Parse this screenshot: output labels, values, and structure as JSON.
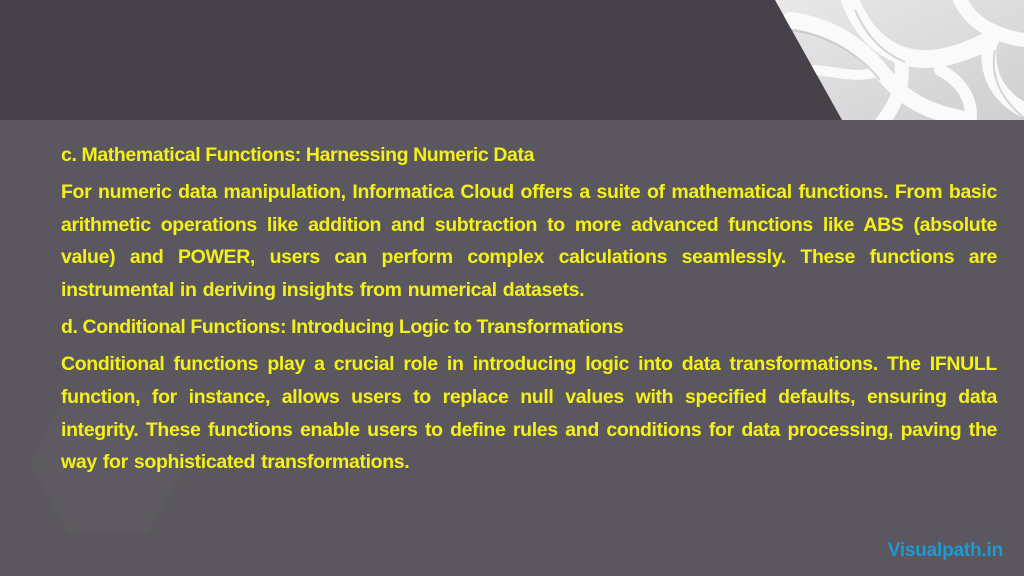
{
  "slide": {
    "colors": {
      "top_band": "#474249",
      "background": "#5a585e",
      "text": "#f4f01a",
      "brand": "#1a9ad6"
    },
    "sections": [
      {
        "heading": "c. Mathematical Functions: Harnessing Numeric Data",
        "body": "For numeric data manipulation, Informatica Cloud offers a suite of mathematical functions. From basic arithmetic operations like addition and subtraction to more advanced functions like ABS (absolute value) and POWER, users can perform complex calculations seamlessly. These functions are instrumental in deriving insights from numerical datasets."
      },
      {
        "heading": "d. Conditional Functions: Introducing Logic to Transformations",
        "body": "Conditional functions play a crucial role in introducing logic into data transformations. The IFNULL function, for instance, allows users to replace null values with specified defaults, ensuring data integrity. These functions enable users to define rules and conditions for data processing, paving the way for sophisticated transformations."
      }
    ],
    "brand": "Visualpath.in",
    "decorations": {
      "corner_image": "white-lattice-3d-pattern",
      "background_shape": "hexagon"
    }
  }
}
